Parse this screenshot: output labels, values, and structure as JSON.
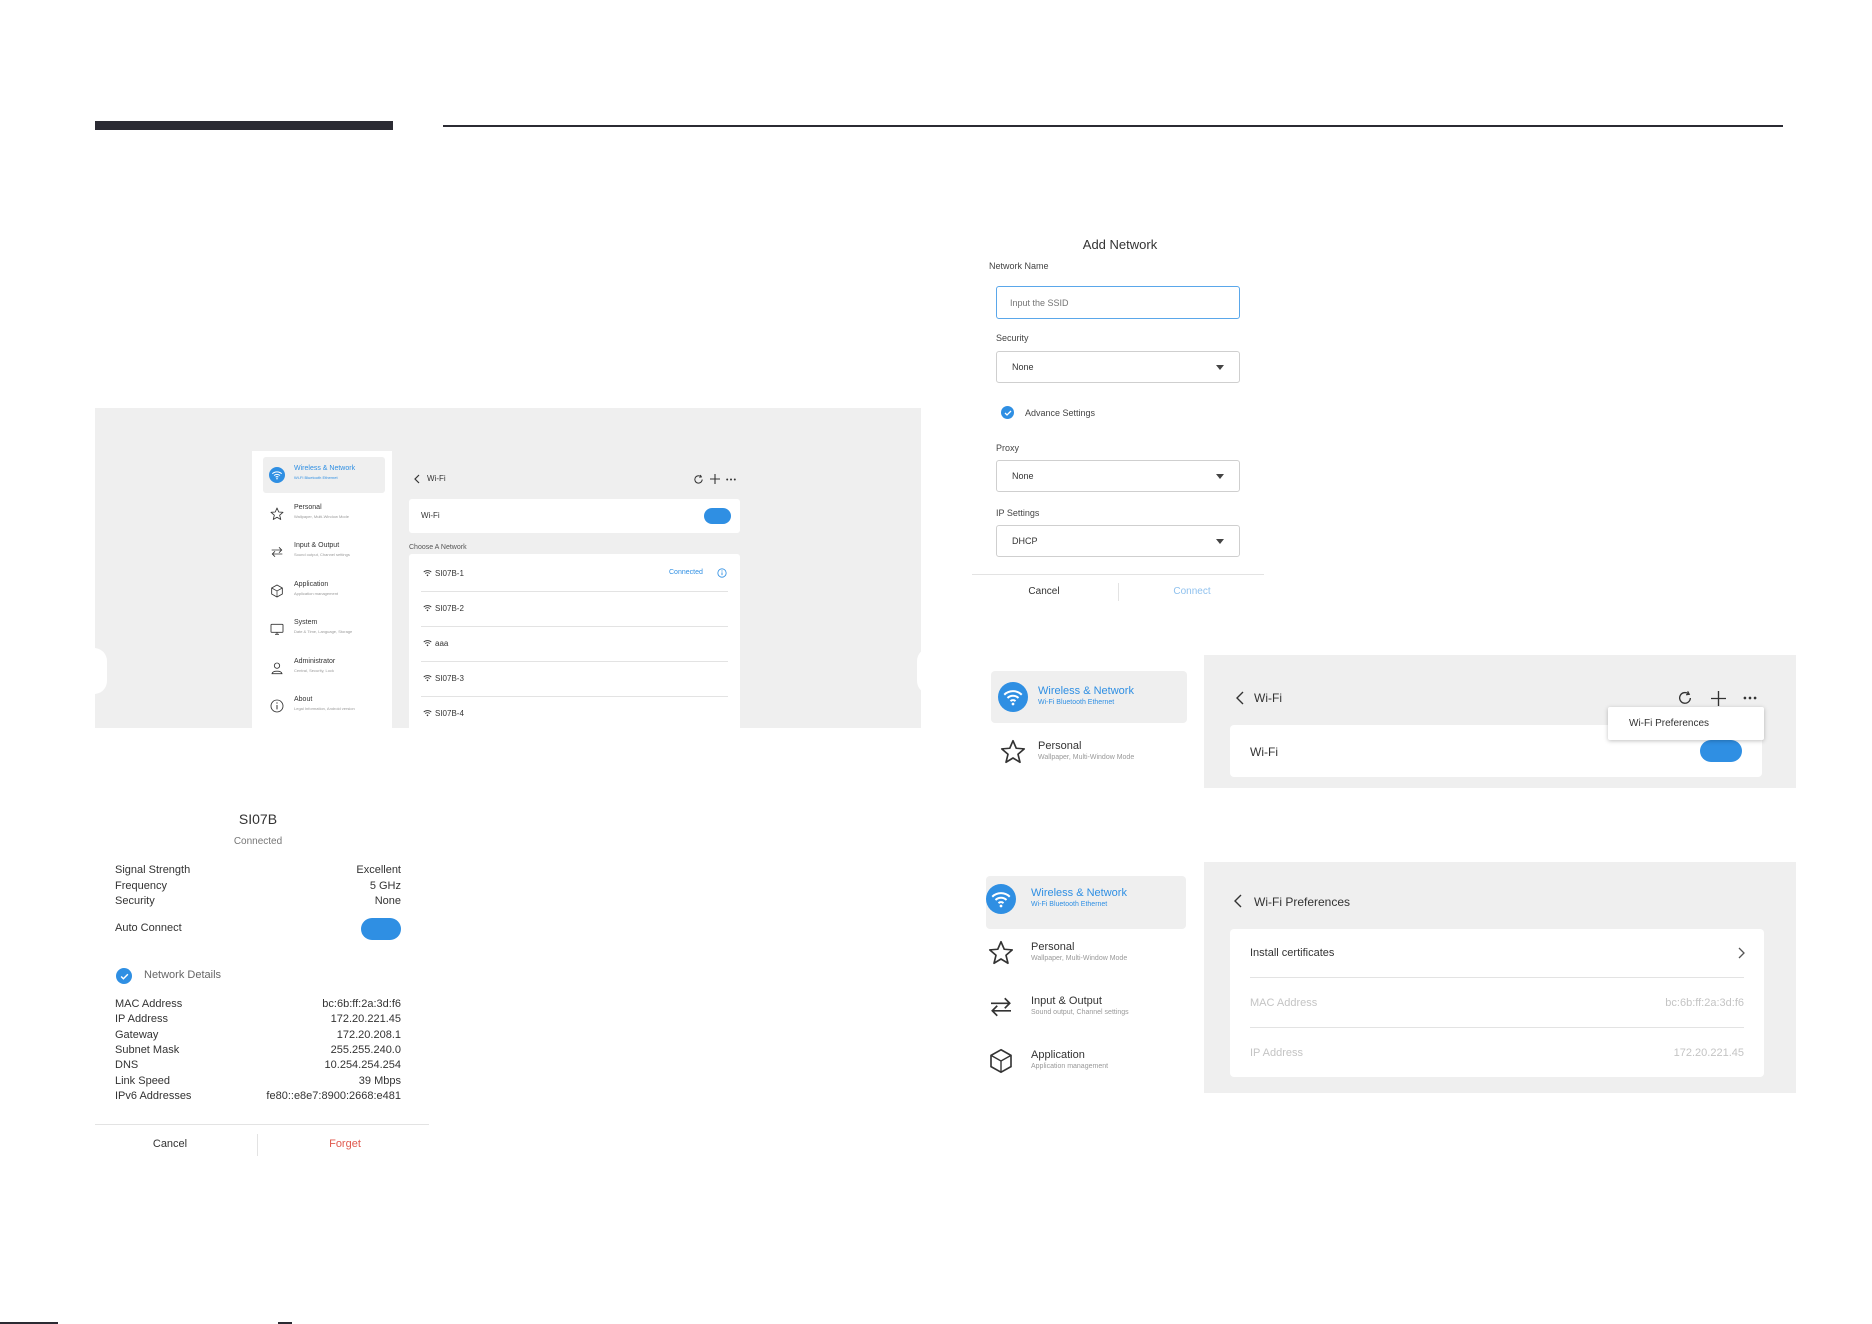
{
  "s1": {
    "sidebar": [
      {
        "title": "Wireless & Network",
        "sub": "Wi-Fi Bluetooth Ethernet",
        "icon": "wifi-icon"
      },
      {
        "title": "Personal",
        "sub": "Wallpaper, Multi-Window Mode",
        "icon": "star-icon"
      },
      {
        "title": "Input & Output",
        "sub": "Sound output, Channel settings",
        "icon": "swap-arrows-icon"
      },
      {
        "title": "Application",
        "sub": "Application management",
        "icon": "hexagon-icon"
      },
      {
        "title": "System",
        "sub": "Date & Time, Language, Storage",
        "icon": "monitor-icon"
      },
      {
        "title": "Administrator",
        "sub": "Central, Security, Lock",
        "icon": "user-icon"
      },
      {
        "title": "About",
        "sub": "Legal Information, Android version",
        "icon": "info-icon"
      }
    ],
    "back_title": "Wi-Fi",
    "wifi_label": "Wi-Fi",
    "choose_label": "Choose A Network",
    "networks": [
      {
        "name": "SI07B-1",
        "status": "Connected"
      },
      {
        "name": "SI07B-2",
        "status": ""
      },
      {
        "name": "aaa",
        "status": ""
      },
      {
        "name": "SI07B-3",
        "status": ""
      },
      {
        "name": "SI07B-4",
        "status": ""
      }
    ]
  },
  "add": {
    "title": "Add Network",
    "name_label": "Network Name",
    "name_placeholder": "Input the SSID",
    "security_label": "Security",
    "security_value": "None",
    "advance_label": "Advance Settings",
    "proxy_label": "Proxy",
    "proxy_value": "None",
    "ip_label": "IP Settings",
    "ip_value": "DHCP",
    "cancel": "Cancel",
    "connect": "Connect"
  },
  "detail": {
    "title": "SI07B",
    "status": "Connected",
    "rows1": [
      {
        "k": "Signal Strength",
        "v": "Excellent"
      },
      {
        "k": "Frequency",
        "v": "5 GHz"
      },
      {
        "k": "Security",
        "v": "None"
      }
    ],
    "auto_connect": "Auto Connect",
    "network_details": "Network Details",
    "rows2": [
      {
        "k": "MAC Address",
        "v": "bc:6b:ff:2a:3d:f6"
      },
      {
        "k": "IP Address",
        "v": "172.20.221.45"
      },
      {
        "k": "Gateway",
        "v": "172.20.208.1"
      },
      {
        "k": "Subnet Mask",
        "v": "255.255.240.0"
      },
      {
        "k": "DNS",
        "v": "10.254.254.254"
      },
      {
        "k": "Link Speed",
        "v": "39 Mbps"
      },
      {
        "k": "IPv6 Addresses",
        "v": "fe80::e8e7:8900:2668:e481"
      }
    ],
    "cancel": "Cancel",
    "forget": "Forget"
  },
  "s2": {
    "sidebar": [
      {
        "title": "Wireless & Network",
        "sub": "Wi-Fi Bluetooth Ethernet"
      },
      {
        "title": "Personal",
        "sub": "Wallpaper, Multi-Window Mode"
      }
    ],
    "back_title": "Wi-Fi",
    "wifi_label": "Wi-Fi",
    "menu_item": "Wi-Fi Preferences"
  },
  "s3": {
    "sidebar": [
      {
        "title": "Wireless & Network",
        "sub": "Wi-Fi Bluetooth Ethernet"
      },
      {
        "title": "Personal",
        "sub": "Wallpaper, Multi-Window Mode"
      },
      {
        "title": "Input & Output",
        "sub": "Sound output, Channel settings"
      },
      {
        "title": "Application",
        "sub": "Application management"
      }
    ],
    "back_title": "Wi-Fi Preferences",
    "install": "Install certificates",
    "mac_label": "MAC Address",
    "mac_value": "bc:6b:ff:2a:3d:f6",
    "ip_label": "IP Address",
    "ip_value": "172.20.221.45"
  },
  "colors": {
    "accent": "#2f8fe3",
    "danger": "#e05a4f",
    "panel": "#efefef"
  }
}
